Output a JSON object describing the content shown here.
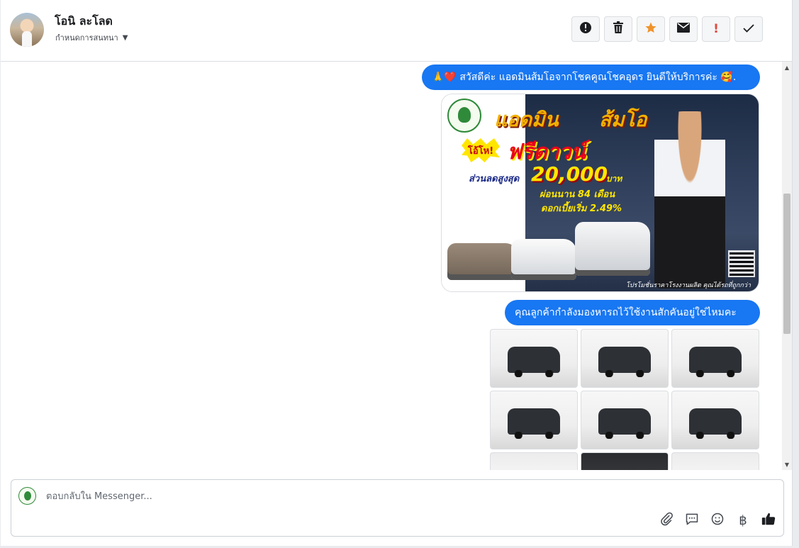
{
  "contact": {
    "name": "โอนิ ละโลด",
    "status_label": "กำหนดการสนทนา"
  },
  "actions": [
    {
      "icon": "alert-circle-icon",
      "glyph": "❗"
    },
    {
      "icon": "trash-icon",
      "glyph": "🗑"
    },
    {
      "icon": "star-icon",
      "glyph": "★"
    },
    {
      "icon": "envelope-icon",
      "glyph": "✉"
    },
    {
      "icon": "exclamation-icon",
      "glyph": "!"
    },
    {
      "icon": "check-icon",
      "glyph": "✓"
    }
  ],
  "messages": {
    "greeting": "🙏❤️ สวัสดีค่ะ แอดมินส้มโอจากโชคคูณโชคอุดร ยินดีให้บริการค่ะ 🥰.",
    "question": "คุณลูกค้ากำลังมองหารถไว้ใช้งานสักคันอยู่ใช่ไหมคะ"
  },
  "promo": {
    "title_part1": "แอดมิน",
    "title_part2": "ส้มโอ",
    "badge": "โอ้โห!",
    "headline": "ฟรีดาวน์",
    "discount_label": "ส่วนลดสูงสุด",
    "discount_value": "20,000",
    "discount_unit": "บาท",
    "installment": "ผ่อนนาน 84 เดือน",
    "interest": "ดอกเบี้ยเริ่ม 2.49%",
    "footer": "โปรโมชั่นราคาโรงงานผลิต คุณได้รถที่ถูกกว่า"
  },
  "composer": {
    "placeholder": "ตอบกลับใน Messenger..."
  },
  "composer_tools": [
    {
      "icon": "paperclip-icon",
      "glyph": "📎"
    },
    {
      "icon": "quick-reply-icon",
      "glyph": "💬"
    },
    {
      "icon": "emoji-icon",
      "glyph": "☺"
    },
    {
      "icon": "baht-icon",
      "glyph": "฿"
    },
    {
      "icon": "thumbs-up-icon",
      "glyph": "👍"
    }
  ],
  "colors": {
    "accent": "#1877f2",
    "star": "#f0932b",
    "warning": "#e4473c"
  }
}
